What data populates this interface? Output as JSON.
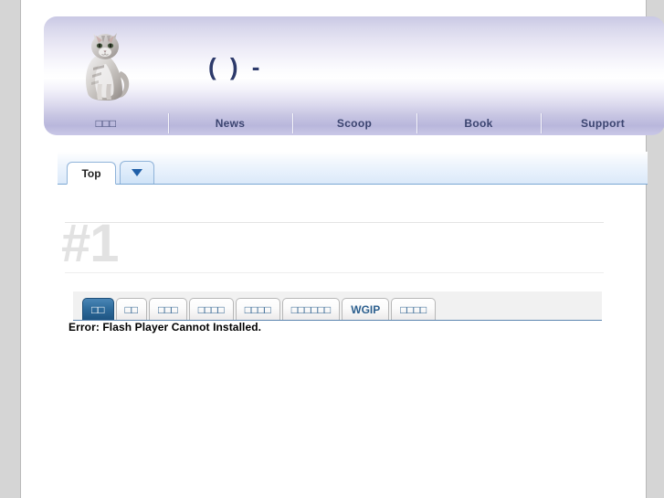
{
  "header": {
    "logo_icon": "cat-photo",
    "title": "(    ) -"
  },
  "nav": {
    "items": [
      {
        "label": "□□□",
        "name": "nav-item-home"
      },
      {
        "label": "News",
        "name": "nav-item-news"
      },
      {
        "label": "Scoop",
        "name": "nav-item-scoop"
      },
      {
        "label": "Book",
        "name": "nav-item-book"
      },
      {
        "label": "Support",
        "name": "nav-item-support"
      }
    ]
  },
  "subtabs": {
    "top_label": "Top",
    "more_icon": "chevron-down-icon"
  },
  "main": {
    "heading": "#1",
    "tabs": [
      {
        "label": "□□",
        "active": true
      },
      {
        "label": "□□",
        "active": false
      },
      {
        "label": "□□□",
        "active": false
      },
      {
        "label": "□□□□",
        "active": false
      },
      {
        "label": "□□□□",
        "active": false
      },
      {
        "label": "□□□□□□",
        "active": false
      },
      {
        "label": "WGIP",
        "active": false
      },
      {
        "label": "□□□□",
        "active": false
      }
    ],
    "error_message": "Error: Flash Player Cannot Installed."
  },
  "colors": {
    "page_background": "#d5d5d5",
    "content_background": "#ffffff",
    "header_accent": "#c9c7e6",
    "nav_text": "#3b4470",
    "title_text": "#2d3a6b",
    "active_tab": "#2f6c9c",
    "tab_text": "#2c5f8e",
    "heading_gray": "#e2e2e2",
    "tab_underline": "#5d86b1",
    "subtab_border": "#7ba7d4"
  }
}
